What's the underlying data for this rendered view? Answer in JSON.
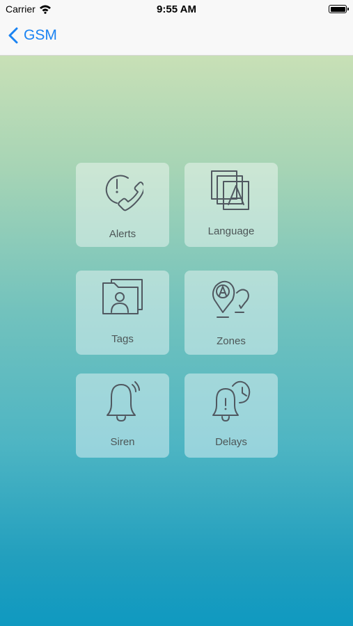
{
  "status_bar": {
    "carrier": "Carrier",
    "time": "9:55 AM"
  },
  "nav": {
    "back_label": "GSM"
  },
  "menu": {
    "alerts": "Alerts",
    "language": "Language",
    "tags": "Tags",
    "zones": "Zones",
    "siren": "Siren",
    "delays": "Delays"
  },
  "colors": {
    "accent": "#1a83f2",
    "gradient_top": "#c8e0b6",
    "gradient_bottom": "#0f99c0",
    "icon_stroke": "#505860"
  }
}
